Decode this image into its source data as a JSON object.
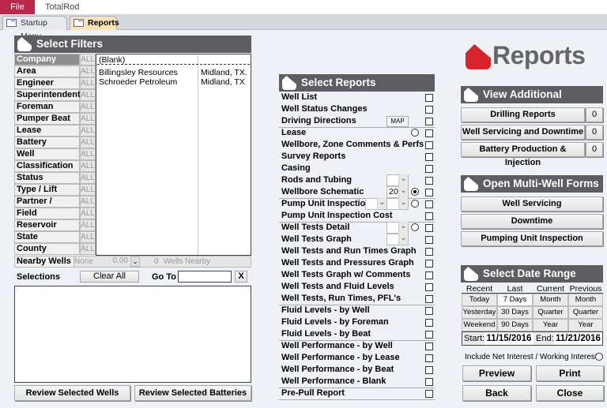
{
  "ribbon": {
    "file": "File",
    "app": "TotalRod"
  },
  "tabs": [
    {
      "label": "Startup Menu"
    },
    {
      "label": "Reports"
    }
  ],
  "filters": {
    "title": "Select Filters",
    "items": [
      {
        "label": "Company",
        "value": "ALL"
      },
      {
        "label": "Area",
        "value": "ALL"
      },
      {
        "label": "Engineer",
        "value": "ALL"
      },
      {
        "label": "Superintendent",
        "value": "ALL"
      },
      {
        "label": "Foreman",
        "value": "ALL"
      },
      {
        "label": "Pumper Beat",
        "value": "ALL"
      },
      {
        "label": "Lease",
        "value": "ALL"
      },
      {
        "label": "Battery",
        "value": "ALL"
      },
      {
        "label": "Well",
        "value": "ALL"
      },
      {
        "label": "Classification",
        "value": "ALL"
      },
      {
        "label": "Status",
        "value": "ALL"
      },
      {
        "label": "Type / Lift",
        "value": "ALL"
      },
      {
        "label": "Partner / Group",
        "value": "ALL"
      },
      {
        "label": "Field",
        "value": "ALL"
      },
      {
        "label": "Reservoir",
        "value": "ALL"
      },
      {
        "label": "State",
        "value": "ALL"
      },
      {
        "label": "County",
        "value": "ALL"
      }
    ],
    "list": [
      {
        "name": "(Blank)",
        "location": ""
      },
      {
        "name": "Billingsley Resources",
        "location": "Midland, TX."
      },
      {
        "name": "Schroeder Petroleum",
        "location": "Midland, TX"
      }
    ],
    "nearby": {
      "label": "Nearby Wells",
      "value": "None",
      "distance": "0.00",
      "count": "0",
      "count_label": "Wells Nearby"
    },
    "selections_label": "Selections",
    "clear_all": "Clear All",
    "goto_label": "Go To",
    "goto_value": "",
    "goto_clear": "X",
    "review_wells": "Review Selected Wells",
    "review_batteries": "Review Selected Batteries"
  },
  "reports": {
    "title": "Select Reports",
    "map_label": "MAP",
    "schematic_value": "20",
    "items": [
      "Well List",
      "Well Status Changes",
      "Driving Directions",
      "Lease",
      "Wellbore, Zone Comments & Perfs",
      "Survey Reports",
      "Casing",
      "Rods and Tubing",
      "Wellbore Schematic",
      "Pump Unit Inspection",
      "Pump Unit Inspection Cost",
      "Well Tests Detail",
      "Well Tests Graph",
      "Well Tests and Run Times Graph",
      "Well Tests and Pressures Graph",
      "Well Tests Graph w/ Comments",
      "Well Tests and Fluid Levels",
      "Well Tests, Run Times, PFL's",
      "Fluid Levels - by Well",
      "Fluid Levels - by Foreman",
      "Fluid Levels - by Beat",
      "Well Performance - by Well",
      "Well Performance - by Lease",
      "Well Performance - by Beat",
      "Well Performance - Blank",
      "Pre-Pull Report"
    ]
  },
  "logo": {
    "title": "Reports",
    "color": "#d9222a"
  },
  "additional": {
    "title": "View Additional Reports",
    "items": [
      {
        "label": "Drilling Reports",
        "count": "0"
      },
      {
        "label": "Well Servicing and Downtime",
        "count": "0"
      },
      {
        "label": "Battery Production & Injection",
        "count": "0"
      }
    ]
  },
  "multiwell": {
    "title": "Open Multi-Well Forms",
    "items": [
      "Well Servicing",
      "Downtime",
      "Pumping Unit Inspection"
    ]
  },
  "daterange": {
    "title": "Select Date Range",
    "columns": [
      "Recent",
      "Last",
      "Current",
      "Previous"
    ],
    "grid": [
      [
        "Today",
        "7 Days",
        "Month",
        "Month"
      ],
      [
        "Yesterday",
        "30 Days",
        "Quarter",
        "Quarter"
      ],
      [
        "Weekend",
        "90 Days",
        "Year",
        "Year"
      ]
    ],
    "start_label": "Start:",
    "start": "11/15/2016",
    "end_label": "End:",
    "end": "11/21/2016",
    "include_label": "Include Net Interest / Working Interest"
  },
  "actions": {
    "preview": "Preview",
    "print": "Print",
    "back": "Back",
    "close": "Close"
  }
}
